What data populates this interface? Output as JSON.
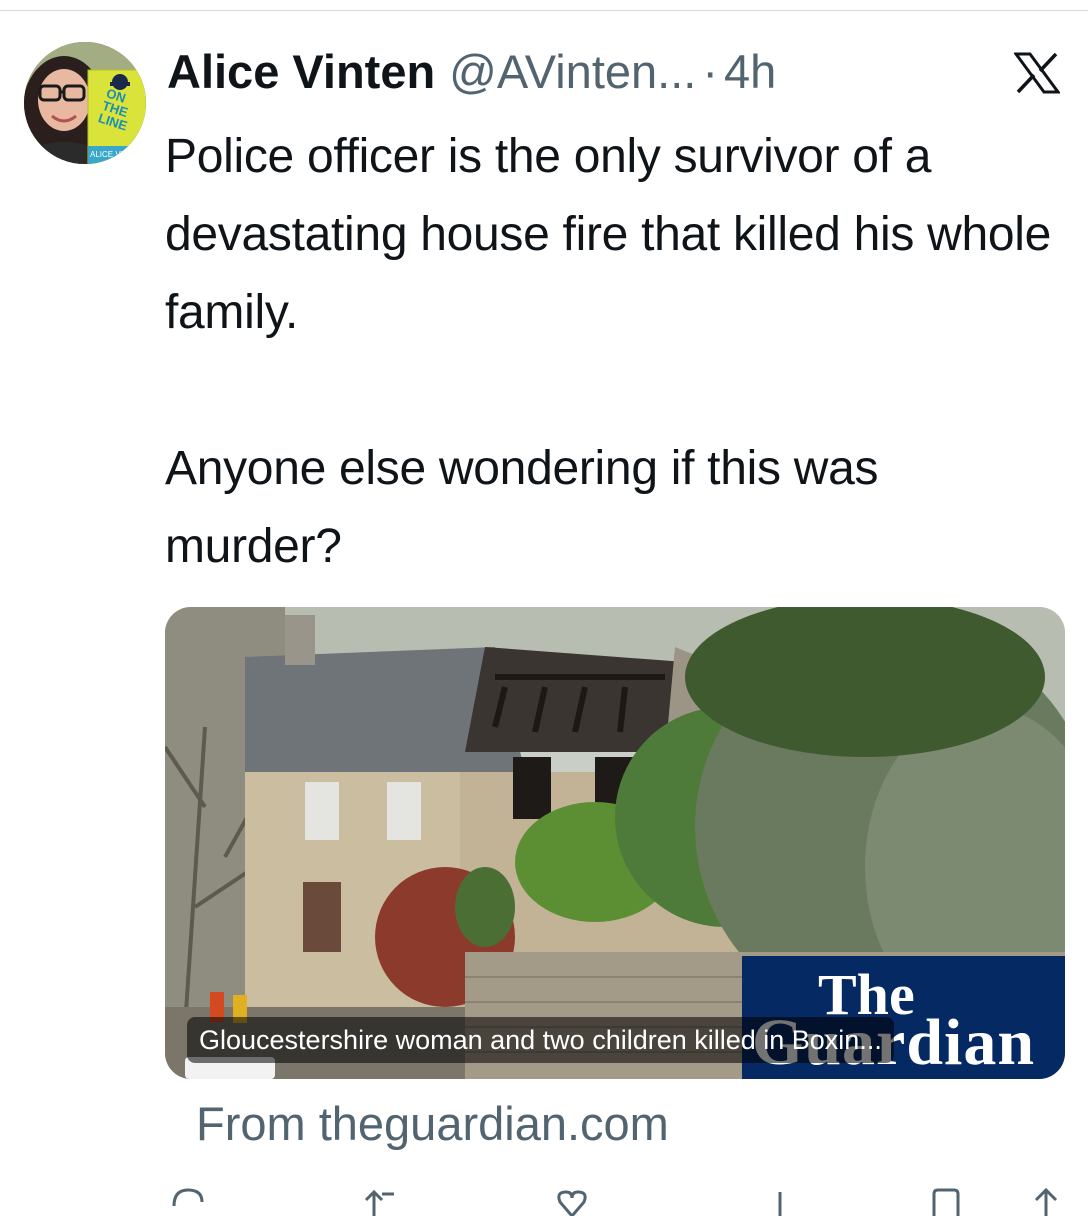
{
  "tweet": {
    "author_name": "Alice Vinten",
    "author_handle": "@AVinten...",
    "separator": "·",
    "timestamp": "4h",
    "text": "Police officer is the only survivor of a devastating house fire that killed his whole family.\n\nAnyone else wondering if this was murder?"
  },
  "avatar": {
    "book_title_lines": [
      "ON",
      "THE",
      "LINE"
    ],
    "book_author": "ALICE VINTEN"
  },
  "card": {
    "caption": "Gloucestershire woman and two children killed in Boxin...",
    "publisher_logo_the": "The",
    "publisher_logo_word": "Guardian",
    "source": "From theguardian.com"
  },
  "icons": {
    "platform": "x-logo-icon",
    "actions": [
      "reply-icon",
      "repost-icon",
      "like-icon",
      "views-icon",
      "bookmark-icon",
      "share-icon"
    ]
  },
  "colors": {
    "text_primary": "#0f1419",
    "text_secondary": "#536471",
    "divider": "#cfd9de",
    "guardian_blue": "#052962"
  }
}
